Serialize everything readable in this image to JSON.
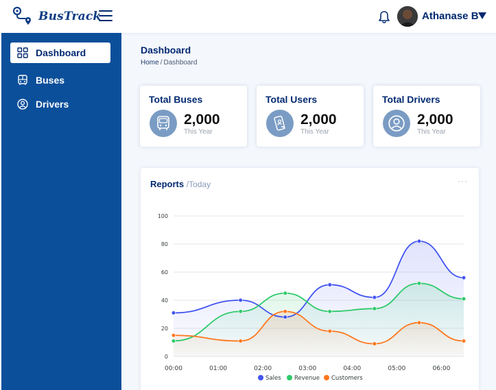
{
  "app": {
    "name": "BusTrack"
  },
  "header": {
    "username": "Athanase B"
  },
  "sidebar": {
    "items": [
      {
        "label": "Dashboard",
        "icon": "grid-icon",
        "active": true
      },
      {
        "label": "Buses",
        "icon": "bus-icon",
        "active": false
      },
      {
        "label": "Drivers",
        "icon": "person-circle-icon",
        "active": false
      }
    ]
  },
  "page": {
    "title": "Dashboard",
    "breadcrumb": {
      "home": "Home",
      "current": "Dashboard"
    }
  },
  "cards": [
    {
      "title": "Total Buses",
      "value": "2,000",
      "sub": "This Year",
      "icon": "bus-icon"
    },
    {
      "title": "Total Users",
      "value": "2,000",
      "sub": "This Year",
      "icon": "phone-user-icon"
    },
    {
      "title": "Total Drivers",
      "value": "2,000",
      "sub": "This Year",
      "icon": "person-circle-icon"
    }
  ],
  "report": {
    "title": "Reports",
    "subtitle": "/Today",
    "menu": "···"
  },
  "colors": {
    "primary": "#012970",
    "sidebar": "#0b4f9b",
    "sales": "#4154f1",
    "revenue": "#2eca6a",
    "customers": "#ff771d"
  },
  "chart_data": {
    "type": "area",
    "x": [
      "00:00",
      "01:00",
      "02:00",
      "03:00",
      "04:00",
      "05:00",
      "06:00"
    ],
    "xlim": [
      0,
      6.5
    ],
    "ylim": [
      0,
      100
    ],
    "yticks": [
      0,
      20,
      40,
      60,
      80,
      100
    ],
    "legend": "bottom",
    "series": [
      {
        "name": "Sales",
        "color": "#4154f1",
        "points": [
          [
            0,
            31
          ],
          [
            1.5,
            40
          ],
          [
            2.5,
            28
          ],
          [
            3.5,
            51
          ],
          [
            4.5,
            42
          ],
          [
            5.5,
            82
          ],
          [
            6.5,
            56
          ]
        ]
      },
      {
        "name": "Revenue",
        "color": "#2eca6a",
        "points": [
          [
            0,
            11
          ],
          [
            1.5,
            32
          ],
          [
            2.5,
            45
          ],
          [
            3.5,
            32
          ],
          [
            4.5,
            34
          ],
          [
            5.5,
            52
          ],
          [
            6.5,
            41
          ]
        ]
      },
      {
        "name": "Customers",
        "color": "#ff771d",
        "points": [
          [
            0,
            15
          ],
          [
            1.5,
            11
          ],
          [
            2.5,
            32
          ],
          [
            3.5,
            18
          ],
          [
            4.5,
            9
          ],
          [
            5.5,
            24
          ],
          [
            6.5,
            11
          ]
        ]
      }
    ]
  }
}
